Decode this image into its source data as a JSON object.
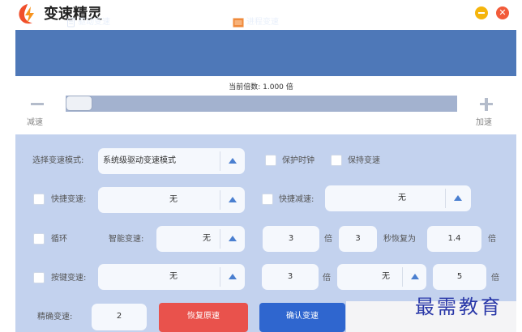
{
  "app": {
    "title": "变速精灵",
    "close_glyph": "✕"
  },
  "nav": {
    "tab_driver": "驱动变速",
    "tab_process": "进程变速"
  },
  "speed": {
    "readout": "当前倍数: 1.000 倍",
    "decrease_label": "减速",
    "increase_label": "加速",
    "slider_fraction": 0.0
  },
  "config": {
    "mode_label": "选择变速模式:",
    "mode_value": "系统级驱动变速模式",
    "protect_clock_label": "保护时钟",
    "keep_speed_label": "保持变速",
    "hotkey_speedup_label": "快捷变速:",
    "hotkey_speedup_value": "无",
    "hotkey_slowdown_label": "快捷减速:",
    "hotkey_slowdown_value": "无",
    "loop_label": "循环",
    "smart_speed_label": "智能变速:",
    "smart_speed_value": "无",
    "loop_multiplier": "3",
    "unit_times": "倍",
    "loop_seconds": "3",
    "restore_label": "秒恢复为",
    "restore_value": "1.4",
    "key_speed_label": "按键变速:",
    "key_speed_value": "无",
    "key_multiplier": "3",
    "key_option_value": "无",
    "key_end_value": "5",
    "precise_label": "精确变速:",
    "precise_value": "2"
  },
  "buttons": {
    "restore_original": "恢复原速",
    "confirm_speed": "确认变速"
  },
  "watermark": "最需教育",
  "colors": {
    "nav": "#4e78b8",
    "panel": "#c3d2ee",
    "red_button": "#e9524c",
    "blue_button": "#2f66cf",
    "accent_triangle": "#4a7fd0"
  }
}
